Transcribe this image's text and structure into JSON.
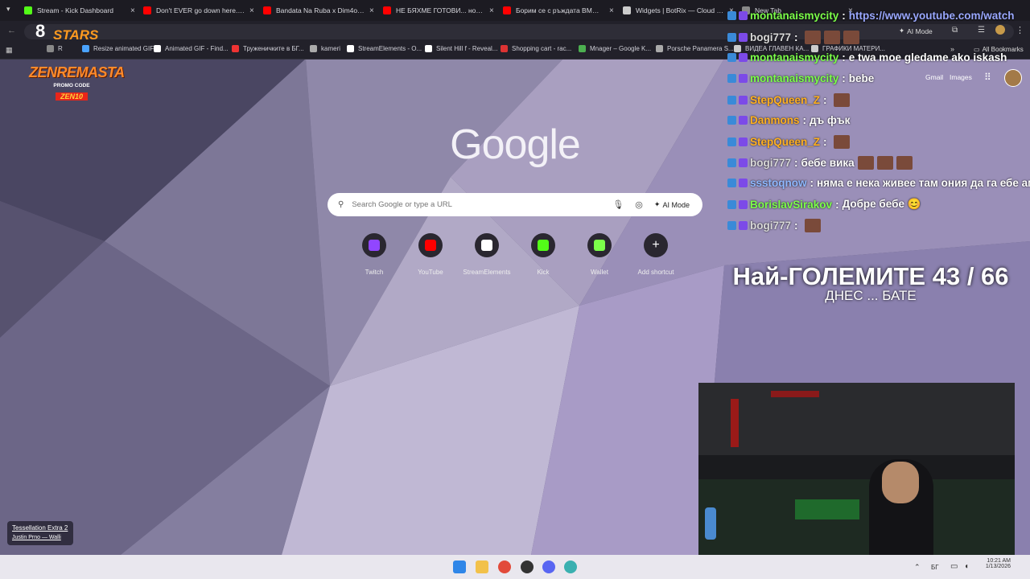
{
  "browser": {
    "tabs": [
      {
        "title": "Stream - Kick Dashboard",
        "color": "#53fc18"
      },
      {
        "title": "Don't EVER go down here... (Pa",
        "color": "#ff0000"
      },
      {
        "title": "Bandata Na Ruba x Dim4ou - Ji",
        "color": "#ff0000"
      },
      {
        "title": "НЕ БЯХМЕ ГОТОВИ... но тръгн",
        "color": "#ff0000"
      },
      {
        "title": "Борим се с ръждата BMW e3",
        "color": "#ff0000"
      },
      {
        "title": "Widgets | BotRix — Cloud Stre",
        "color": "#cccccc"
      },
      {
        "title": "New Tab",
        "color": "#888888"
      }
    ],
    "toolbar": {
      "ai_mode": "AI Mode"
    },
    "bookmarks": [
      {
        "label": "R",
        "color": "#888"
      },
      {
        "label": "Resize animated GIF",
        "color": "#4aa3ff"
      },
      {
        "label": "Animated GIF - Find...",
        "color": "#ffffff"
      },
      {
        "label": "Труженичките в БГ...",
        "color": "#e33"
      },
      {
        "label": "kameri",
        "color": "#aaa"
      },
      {
        "label": "StreamElements - O...",
        "color": "#fff"
      },
      {
        "label": "Silent Hill f - Reveal...",
        "color": "#fff"
      },
      {
        "label": "Shopping cart - rac...",
        "color": "#d33"
      },
      {
        "label": "Mnager – Google K...",
        "color": "#4caf50"
      },
      {
        "label": "Porsche Panamera S...",
        "color": "#aaa"
      },
      {
        "label": "ВИДЕА ГЛАВЕН КА...",
        "color": "#ccc"
      },
      {
        "label": "ГРАФИКИ МАТЕРИ...",
        "color": "#ccc"
      }
    ],
    "all_bookmarks": "All Bookmarks"
  },
  "google": {
    "logo": "Google",
    "gmail": "Gmail",
    "images": "Images",
    "search_placeholder": "Search Google or type a URL",
    "ai_mode": "AI Mode",
    "shortcuts": [
      {
        "label": "Twitch",
        "icon": "twitch-icon",
        "color": "#9146ff"
      },
      {
        "label": "YouTube",
        "icon": "youtube-icon",
        "color": "#ff0000"
      },
      {
        "label": "StreamElements",
        "icon": "streamelements-icon",
        "color": "#ffffff"
      },
      {
        "label": "Kick",
        "icon": "kick-icon",
        "color": "#53fc18"
      },
      {
        "label": "Wallet",
        "icon": "wallet-icon",
        "color": "#7cff4a"
      },
      {
        "label": "Add shortcut",
        "icon": "plus-icon",
        "color": "#ffffff"
      }
    ],
    "customize": {
      "title": "Tessellation Extra 2",
      "author": "Justin Prno — Walli"
    }
  },
  "overlay": {
    "sponsor": {
      "brand": "ZENREMASTA",
      "promo_label": "PROMO CODE",
      "code": "ZEN10"
    },
    "logo": "STARS",
    "chat": [
      {
        "user": "montanaismycity",
        "color": "#7cff4a",
        "msg": "https://www.youtube.com/watch",
        "msg_color": "#9aa8ff",
        "emotes": 0
      },
      {
        "user": "bogi777",
        "color": "#d9d9d9",
        "msg": "",
        "msg_color": "#ffffff",
        "emotes": 3
      },
      {
        "user": "montanaismycity",
        "color": "#7cff4a",
        "msg": "e twa moe gledame ako iskash",
        "msg_color": "#ffffff",
        "emotes": 0
      },
      {
        "user": "montanaismycity",
        "color": "#7cff4a",
        "msg": "bebe",
        "msg_color": "#ffffff",
        "emotes": 0
      },
      {
        "user": "StepQueen_Z",
        "color": "#ffb020",
        "msg": "",
        "msg_color": "#ffffff",
        "emotes": 1
      },
      {
        "user": "Danmons",
        "color": "#ffb020",
        "msg": "дъ фък",
        "msg_color": "#ffffff",
        "emotes": 0
      },
      {
        "user": "StepQueen_Z",
        "color": "#ffb020",
        "msg": "",
        "msg_color": "#ffffff",
        "emotes": 1
      },
      {
        "user": "bogi777",
        "color": "#d9d9d9",
        "msg": "бебе вика",
        "msg_color": "#ffffff",
        "emotes": 3
      },
      {
        "user": "ssstoqnow",
        "color": "#8fb8ff",
        "msg": "няма е нека живее там ония да га ебе ам",
        "msg_color": "#ffffff",
        "emotes": 0
      },
      {
        "user": "BorislavSirakov",
        "color": "#7cff4a",
        "msg": "Добре бебе 😊",
        "msg_color": "#ffffff",
        "emotes": 0
      },
      {
        "user": "bogi777",
        "color": "#d9d9d9",
        "msg": "",
        "msg_color": "#ffffff",
        "emotes": 1
      }
    ],
    "goal_title": "Най-ГОЛЕМИТЕ 43 / 66",
    "goal_subtitle": "ДНЕС ... БАТЕ"
  },
  "taskbar": {
    "lang": "БГ",
    "time": "10:21 AM",
    "date": "1/13/2026"
  }
}
